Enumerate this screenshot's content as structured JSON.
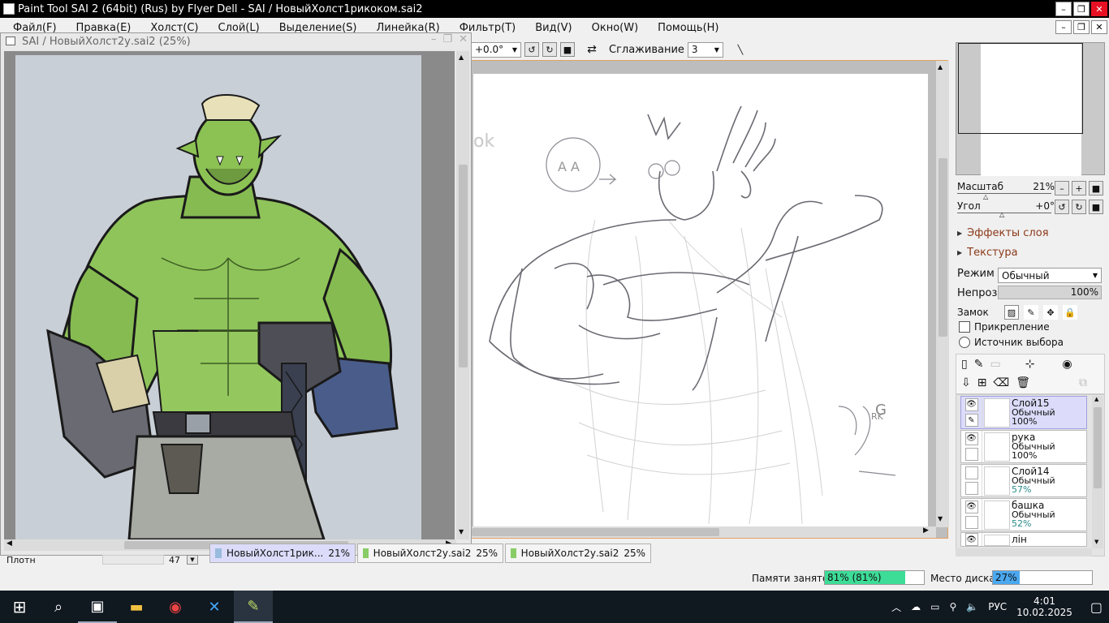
{
  "app": {
    "title": "Paint Tool SAI 2 (64bit) (Rus) by Flyer Dell - SAI / НовыйХолст1рикоком.sai2"
  },
  "menu": [
    "Файл(F)",
    "Правка(E)",
    "Холст(C)",
    "Слой(L)",
    "Выделение(S)",
    "Линейка(R)",
    "Фильтр(T)",
    "Вид(V)",
    "Окно(W)",
    "Помощь(H)"
  ],
  "toolbar": {
    "angle_value": "+0.0°",
    "smoothing_label": "Сглаживание",
    "smoothing_value": "3"
  },
  "subwindow": {
    "title": "SAI / НовыйХолст2у.sai2 (25%)"
  },
  "canvas_notes": {
    "top_left": "ok",
    "circle_text": "A A",
    "right_g": "G",
    "right_rk": "RK"
  },
  "navigator": {
    "zoom_label": "Масштаб",
    "zoom_value": "21%",
    "angle_label": "Угол",
    "angle_value": "+0°"
  },
  "panels": {
    "effects": "Эффекты слоя",
    "texture": "Текстура",
    "mode_label": "Режим",
    "mode_value": "Обычный",
    "opacity_label": "Непроз.",
    "opacity_value": "100%",
    "lock_label": "Замок",
    "clipping": "Прикрепление",
    "selection_source": "Источник выбора"
  },
  "layers": [
    {
      "name": "Слой15",
      "mode": "Обычный",
      "opacity": "100%",
      "visible": true,
      "selected": true
    },
    {
      "name": "рука",
      "mode": "Обычный",
      "opacity": "100%",
      "visible": true,
      "selected": false
    },
    {
      "name": "Слой14",
      "mode": "Обычный",
      "opacity": "57%",
      "visible": false,
      "selected": false
    },
    {
      "name": "башка",
      "mode": "Обычный",
      "opacity": "52%",
      "visible": true,
      "selected": false
    },
    {
      "name": "лін",
      "mode": "",
      "opacity": "",
      "visible": true,
      "selected": false
    }
  ],
  "doc_tabs": [
    {
      "name": "НовыйХолст1рик...",
      "zoom": "21%"
    },
    {
      "name": "НовыйХолст2у.sai2",
      "zoom": "25%"
    },
    {
      "name": "НовыйХолст2у.sai2",
      "zoom": "25%"
    }
  ],
  "brush_bar": {
    "label": "Плотн",
    "value": "47"
  },
  "status": {
    "memory_label": "Памяти занято",
    "memory_value": "81% (81%)",
    "memory_fraction": 0.81,
    "disk_label": "Место диска",
    "disk_value": "27%",
    "disk_fraction": 0.27
  },
  "taskbar": {
    "time": "4:01",
    "date": "10.02.2025",
    "lang": "РУС"
  },
  "colors": {
    "memory_bar": "#3ddc97",
    "disk_bar": "#4aa8f0",
    "selected_layer": "#dcdcfa"
  }
}
